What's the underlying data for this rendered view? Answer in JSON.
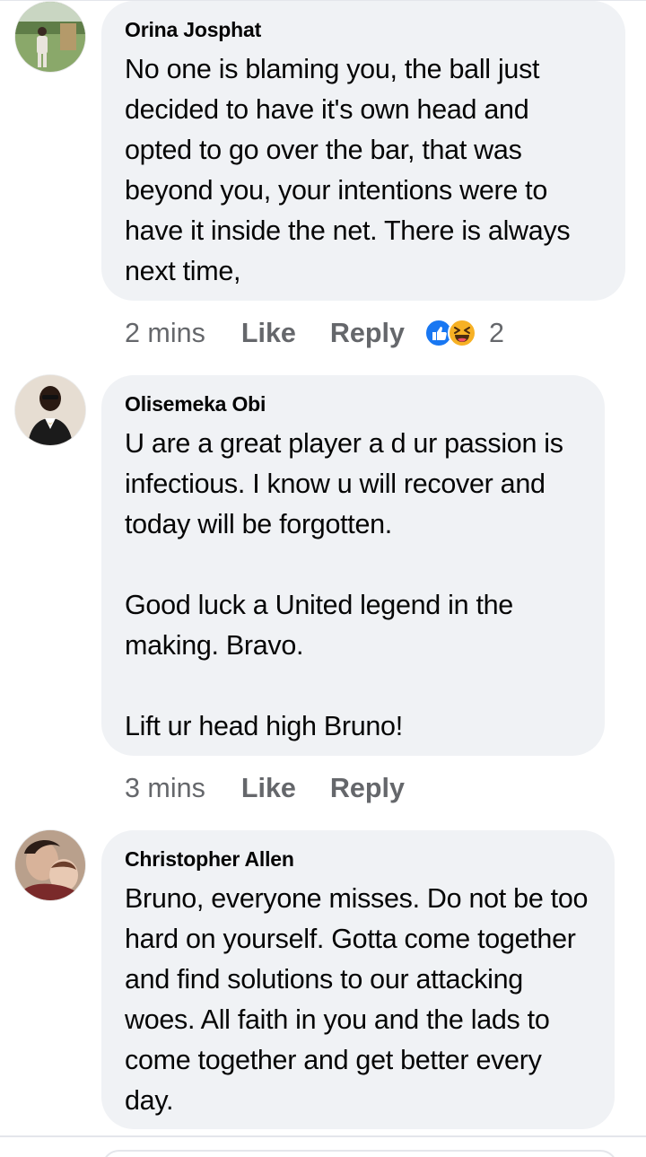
{
  "comments": [
    {
      "author": "Orina Josphat",
      "text": "No one is blaming you, the ball just decided to have it's own head and opted to go over the bar, that was beyond you, your intentions were to have it inside the net. There is always next time,",
      "time": "2 mins",
      "like_label": "Like",
      "reply_label": "Reply",
      "reaction_icons": [
        "like-reaction-icon",
        "haha-reaction-icon"
      ],
      "reaction_count": "2"
    },
    {
      "author": "Olisemeka Obi",
      "text": "U are a great player a d ur passion is infectious. I know u will recover and today will be forgotten.\n\nGood luck a United legend in the making. Bravo.\n\nLift ur head high Bruno!",
      "time": "3 mins",
      "like_label": "Like",
      "reply_label": "Reply"
    },
    {
      "author": "Christopher Allen",
      "text": "Bruno, everyone misses. Do not be too hard on yourself. Gotta come together and find solutions to our attacking woes. All faith in you and the lads to come together and get better every day."
    }
  ],
  "colors": {
    "bubble_bg": "#f0f2f5",
    "meta_text": "#65676b",
    "like_blue": "#1877f2",
    "haha_yellow": "#f7b125"
  }
}
